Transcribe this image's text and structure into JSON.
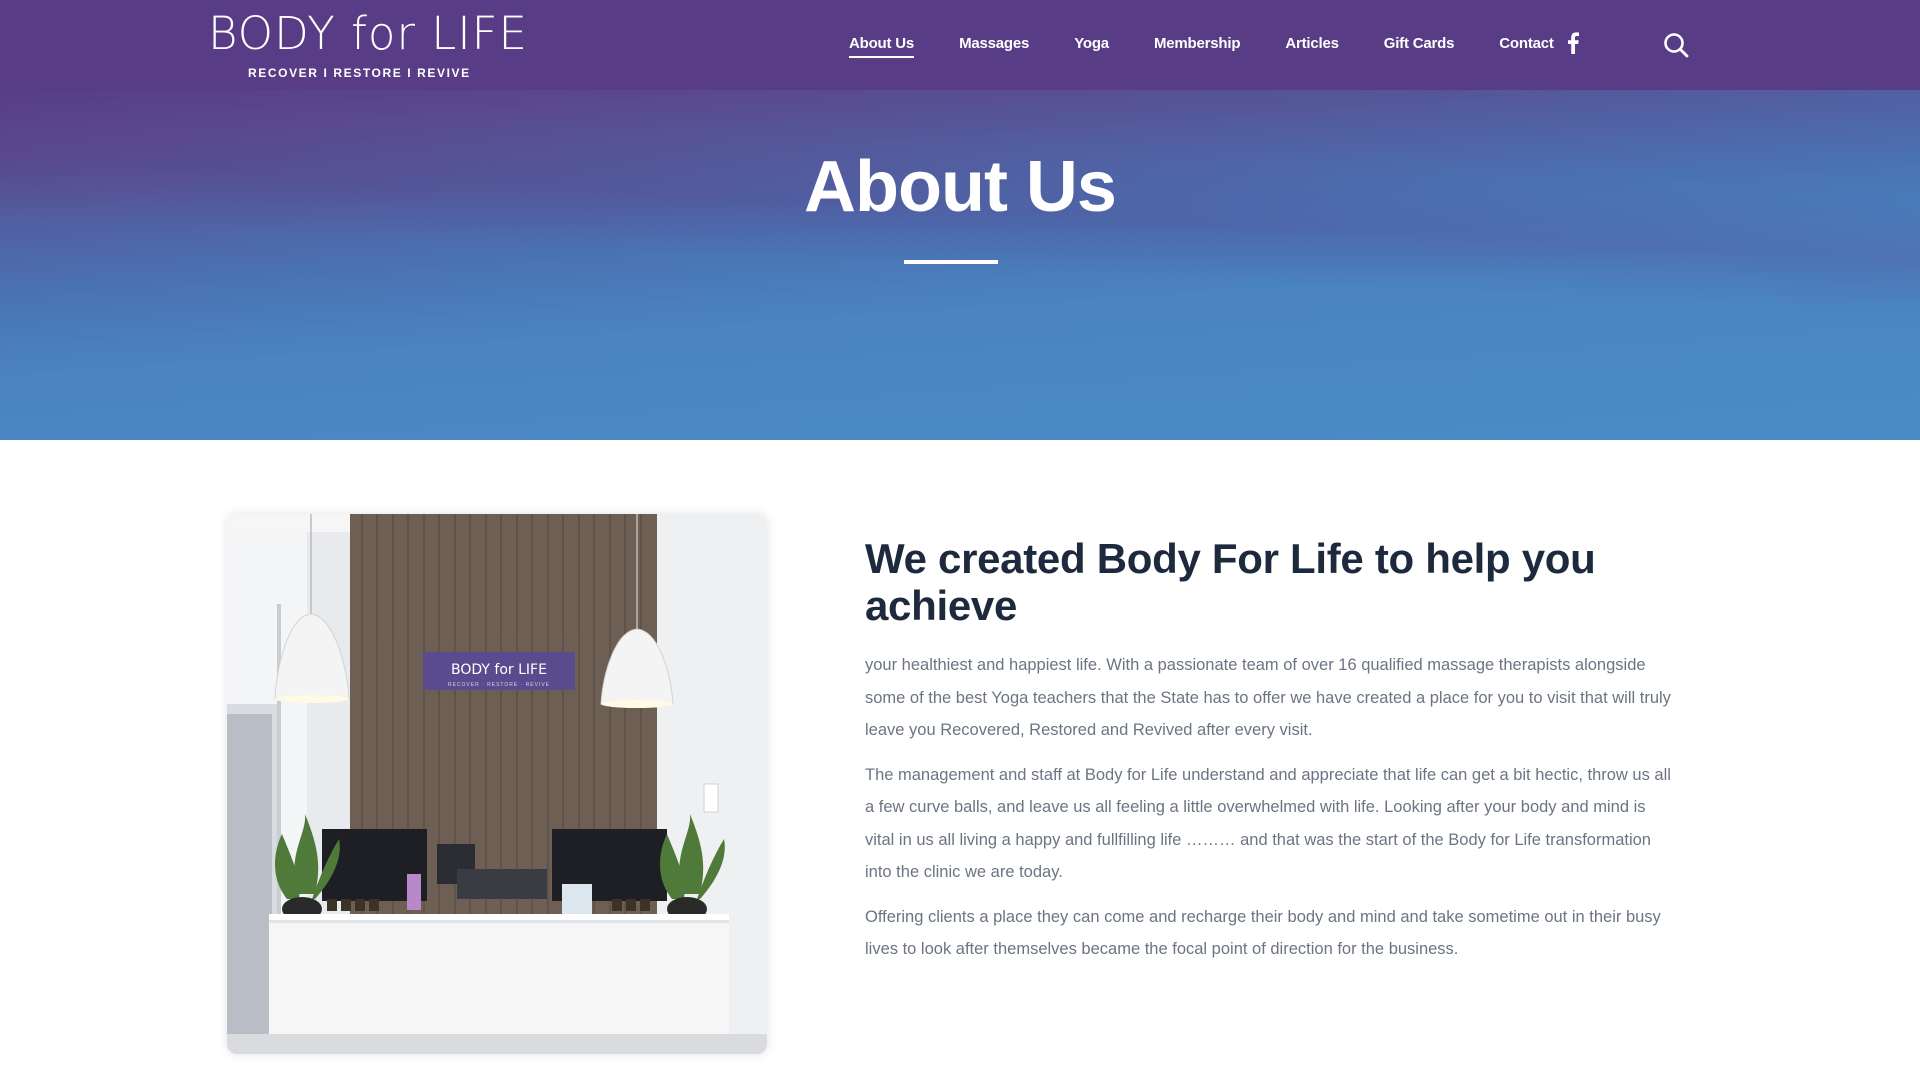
{
  "brand": {
    "logo_text": "BODY for LIFE",
    "tagline": "RECOVER  I  RESTORE  I  REVIVE"
  },
  "nav": {
    "items": [
      {
        "label": "About Us",
        "active": true
      },
      {
        "label": "Massages",
        "active": false
      },
      {
        "label": "Yoga",
        "active": false
      },
      {
        "label": "Membership",
        "active": false
      },
      {
        "label": "Articles",
        "active": false
      },
      {
        "label": "Gift Cards",
        "active": false
      },
      {
        "label": "Contact",
        "active": false
      }
    ],
    "social_icon": "facebook-icon",
    "search_icon": "search-icon"
  },
  "hero": {
    "title": "About Us"
  },
  "photo": {
    "sign_text": "BODY for LIFE",
    "description_icon": "reception-desk-photo"
  },
  "content": {
    "heading": "We created Body For Life to help you achieve",
    "paragraphs": [
      "your healthiest and happiest life. With a passionate team of over 16 qualified massage therapists alongside some of the best Yoga teachers that the State has to offer we have created a place for you to visit that will truly leave you Recovered, Restored and Revived after every visit.",
      "The management and staff at Body for Life understand and appreciate that life can get a bit hectic, throw us all a few curve balls, and leave us all feeling a little overwhelmed with life.  Looking after your body and mind is vital in us all living a happy and fullfilling life ……… and that was the start of the Body for Life transformation into the clinic we are today.",
      "Offering clients a place they can come and recharge their body and mind and take sometime out in their busy lives to look after themselves became the focal point of direction for the business."
    ]
  },
  "colors": {
    "header_bg": "#583d86",
    "hero_top": "#583d86",
    "hero_bottom": "#4a8bc6",
    "heading_text": "#1d2a3d",
    "body_text": "#6c7484"
  }
}
